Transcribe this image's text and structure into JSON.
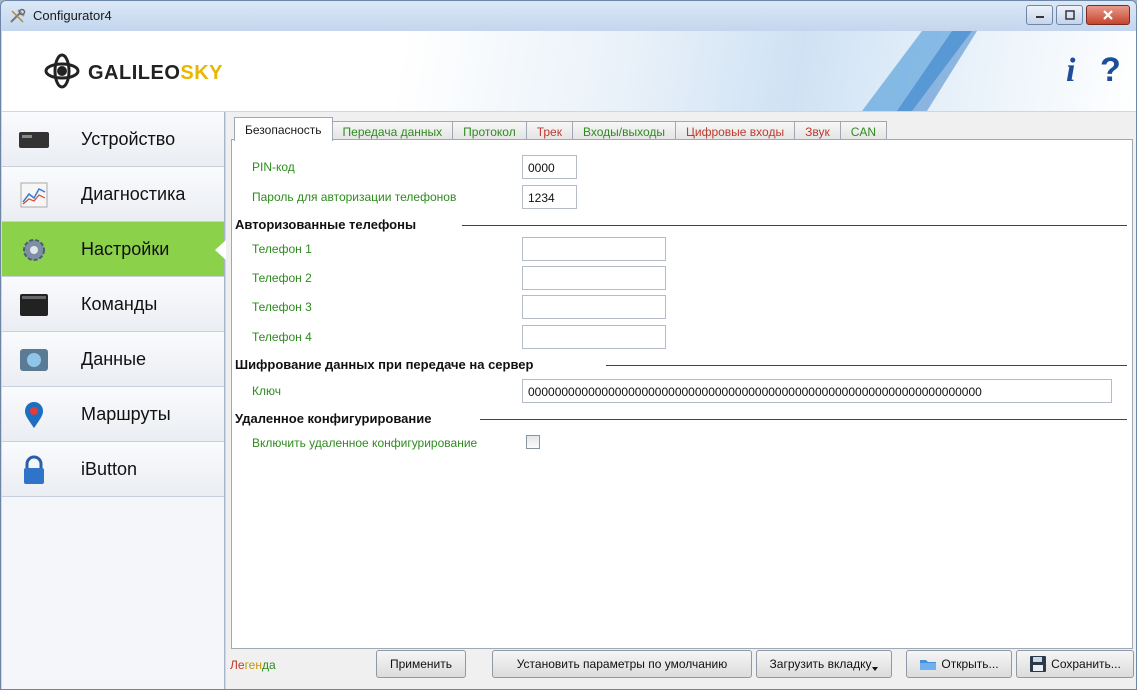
{
  "window": {
    "title": "Configurator4"
  },
  "banner": {
    "logo_text_a": "GALILEO",
    "logo_text_b": "SKY",
    "info_glyph": "i",
    "help_glyph": "?"
  },
  "sidebar": {
    "items": [
      {
        "label": "Устройство",
        "icon": "device-icon"
      },
      {
        "label": "Диагностика",
        "icon": "chart-icon"
      },
      {
        "label": "Настройки",
        "icon": "gear-icon",
        "active": true
      },
      {
        "label": "Команды",
        "icon": "terminal-icon"
      },
      {
        "label": "Данные",
        "icon": "data-icon"
      },
      {
        "label": "Маршруты",
        "icon": "map-pin-icon"
      },
      {
        "label": "iButton",
        "icon": "lock-icon"
      }
    ]
  },
  "tabs": [
    {
      "label": "Безопасность",
      "active": true
    },
    {
      "label": "Передача данных"
    },
    {
      "label": "Протокол"
    },
    {
      "label": "Трек"
    },
    {
      "label": "Входы/выходы"
    },
    {
      "label": "Цифровые входы"
    },
    {
      "label": "Звук"
    },
    {
      "label": "CAN"
    }
  ],
  "security": {
    "pin_label": "PIN-код",
    "pin_value": "0000",
    "phone_password_label": "Пароль для авторизации телефонов",
    "phone_password_value": "1234",
    "auth_phones_section": "Авторизованные телефоны",
    "phone1_label": "Телефон 1",
    "phone2_label": "Телефон 2",
    "phone3_label": "Телефон 3",
    "phone4_label": "Телефон 4",
    "phone1_value": "",
    "phone2_value": "",
    "phone3_value": "",
    "phone4_value": "",
    "encryption_section": "Шифрование данных при передаче на сервер",
    "key_label": "Ключ",
    "key_value": "00000000000000000000000000000000000000000000000000000000000000000000",
    "remote_section": "Удаленное конфигурирование",
    "remote_checkbox_label": "Включить удаленное конфигурирование",
    "remote_checked": false
  },
  "footer": {
    "legend_a": "Ле",
    "legend_b": "ген",
    "legend_c": "да",
    "apply_label": "Применить",
    "defaults_label": "Установить параметры по умолчанию",
    "load_tab_label": "Загрузить вкладку",
    "open_label": "Открыть...",
    "save_label": "Сохранить..."
  },
  "colors": {
    "active_sidebar": "#8bd14a",
    "label_green": "#2e8b1e",
    "label_red": "#c0392b"
  }
}
